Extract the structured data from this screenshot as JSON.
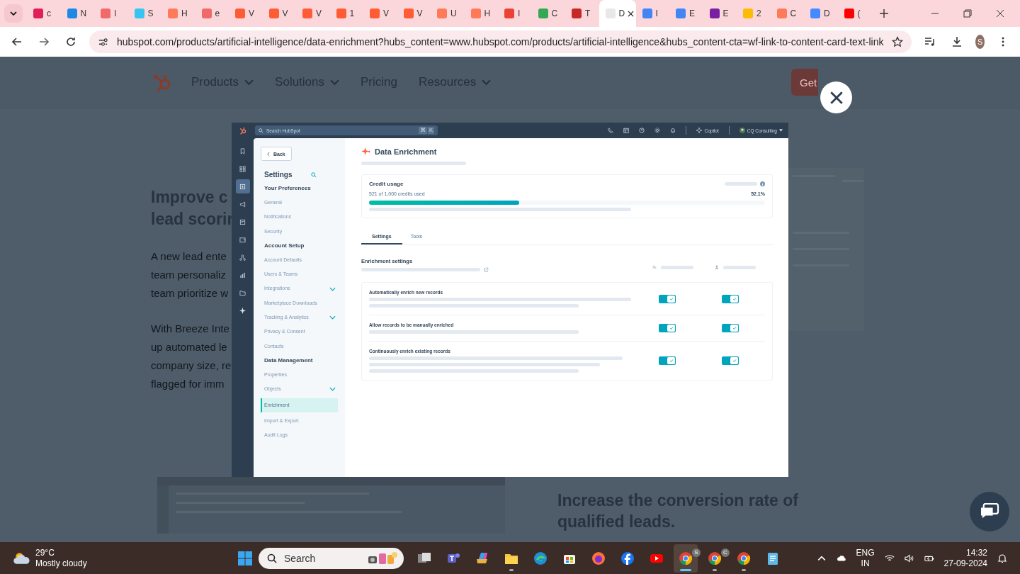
{
  "browser": {
    "tabs": [
      {
        "title": "c",
        "color": "#e01e5a",
        "selected": false
      },
      {
        "title": "N",
        "color": "#1e88e5",
        "selected": false
      },
      {
        "title": "I",
        "color": "#f06a6a",
        "selected": false
      },
      {
        "title": "S",
        "color": "#36c5f0",
        "selected": false
      },
      {
        "title": "H",
        "color": "#ff7a59",
        "selected": false
      },
      {
        "title": "e",
        "color": "#f06a6a",
        "selected": false
      },
      {
        "title": "V",
        "color": "#ff5c35",
        "selected": false
      },
      {
        "title": "V",
        "color": "#ff5c35",
        "selected": false
      },
      {
        "title": "V",
        "color": "#ff5c35",
        "selected": false
      },
      {
        "title": "1",
        "color": "#ff5c35",
        "selected": false
      },
      {
        "title": "V",
        "color": "#ff5c35",
        "selected": false
      },
      {
        "title": "V",
        "color": "#ff5c35",
        "selected": false
      },
      {
        "title": "U",
        "color": "#ff7a59",
        "selected": false
      },
      {
        "title": "H",
        "color": "#ff7a59",
        "selected": false
      },
      {
        "title": "I",
        "color": "#ea4335",
        "selected": false
      },
      {
        "title": "C",
        "color": "#34a853",
        "selected": false
      },
      {
        "title": "T",
        "color": "#c62828",
        "selected": false
      },
      {
        "title": "D",
        "color": "#e8e8e8",
        "selected": true
      },
      {
        "title": "I",
        "color": "#4285f4",
        "selected": false
      },
      {
        "title": "E",
        "color": "#4285f4",
        "selected": false
      },
      {
        "title": "E",
        "color": "#7b1fa2",
        "selected": false
      },
      {
        "title": "2",
        "color": "#fbbc05",
        "selected": false
      },
      {
        "title": "C",
        "color": "#ff7a59",
        "selected": false
      },
      {
        "title": "D",
        "color": "#448aff",
        "selected": false
      },
      {
        "title": "(",
        "color": "#ff0000",
        "selected": false
      }
    ],
    "url": "hubspot.com/products/artificial-intelligence/data-enrichment?hubs_content=www.hubspot.com/products/artificial-intelligence&hubs_content-cta=wf-link-to-content-card-text-link",
    "profile_initial": "S"
  },
  "page": {
    "nav": [
      {
        "label": "Products",
        "has_menu": true
      },
      {
        "label": "Solutions",
        "has_menu": true
      },
      {
        "label": "Pricing",
        "has_menu": false
      },
      {
        "label": "Resources",
        "has_menu": true
      }
    ],
    "demo_button": "Get",
    "headline_lines": [
      "Improve c",
      "lead scorir"
    ],
    "paragraph_1": [
      "A new lead ente",
      "team personaliz",
      "team prioritize w"
    ],
    "paragraph_2": [
      "With Breeze Inte",
      "up automated le",
      "company size, re",
      "flagged for imm"
    ],
    "section_heading_lines": [
      "Increase the conversion rate of",
      "qualified leads."
    ]
  },
  "modal": {
    "search_placeholder": "Search HubSpot",
    "shortcut_keys": [
      "⌘",
      "K"
    ],
    "copilot": "Copilot",
    "account": "CQ Consulting",
    "rail": [
      {
        "kind": "bookmark",
        "selected": false
      },
      {
        "kind": "grid",
        "selected": false
      },
      {
        "kind": "inbox",
        "selected": true
      },
      {
        "kind": "megaphone",
        "selected": false
      },
      {
        "kind": "document",
        "selected": false
      },
      {
        "kind": "wallet",
        "selected": false
      },
      {
        "kind": "network",
        "selected": false
      },
      {
        "kind": "chart",
        "selected": false
      },
      {
        "kind": "folder",
        "selected": false
      },
      {
        "kind": "sparkle",
        "selected": false
      }
    ],
    "back": "Back",
    "settings_title": "Settings",
    "nav_groups": [
      {
        "heading": "Your Preferences",
        "items": [
          {
            "label": "General",
            "expandable": false,
            "selected": false
          },
          {
            "label": "Notifications",
            "expandable": false,
            "selected": false
          },
          {
            "label": "Security",
            "expandable": false,
            "selected": false
          }
        ]
      },
      {
        "heading": "Account Setup",
        "items": [
          {
            "label": "Account Defaults",
            "expandable": false,
            "selected": false
          },
          {
            "label": "Users & Teams",
            "expandable": false,
            "selected": false
          },
          {
            "label": "Integrations",
            "expandable": true,
            "selected": false
          },
          {
            "label": "Marketplace Downloads",
            "expandable": false,
            "selected": false
          },
          {
            "label": "Tracking & Analytics",
            "expandable": true,
            "selected": false
          },
          {
            "label": "Privacy & Consent",
            "expandable": false,
            "selected": false
          },
          {
            "label": "Contacts",
            "expandable": false,
            "selected": false
          }
        ]
      },
      {
        "heading": "Data Management",
        "items": [
          {
            "label": "Properties",
            "expandable": false,
            "selected": false
          },
          {
            "label": "Objects",
            "expandable": true,
            "selected": false
          },
          {
            "label": "Enrichment",
            "expandable": false,
            "selected": true
          },
          {
            "label": "Import & Export",
            "expandable": false,
            "selected": false
          },
          {
            "label": "Audit Logs",
            "expandable": false,
            "selected": false
          }
        ]
      }
    ],
    "title": "Data Enrichment",
    "credit": {
      "title": "Credit usage",
      "used": "521 of 1,000 credits used",
      "percent": "52.1%",
      "level": 0.38
    },
    "tabs": [
      {
        "label": "Settings",
        "selected": true
      },
      {
        "label": "Tools",
        "selected": false
      }
    ],
    "section_title": "Enrichment settings",
    "settings": [
      {
        "label": "Automatically enrich new records",
        "toggles": [
          {
            "on": true
          },
          {
            "on": true
          }
        ]
      },
      {
        "label": "Allow records to be manually enriched",
        "toggles": [
          {
            "on": true
          },
          {
            "on": true
          }
        ]
      },
      {
        "label": "Continuously enrich existing records",
        "toggles": [
          {
            "on": true
          },
          {
            "on": true
          }
        ]
      }
    ]
  },
  "taskbar": {
    "temperature": "29°C",
    "weather": "Mostly cloudy",
    "search": "Search",
    "apps": [
      {
        "kind": "task-view",
        "running": false,
        "active": false
      },
      {
        "kind": "teams",
        "running": false,
        "active": false
      },
      {
        "kind": "copilot",
        "running": false,
        "active": false
      },
      {
        "kind": "files",
        "running": true,
        "active": false
      },
      {
        "kind": "edge",
        "running": false,
        "active": false
      },
      {
        "kind": "store",
        "running": false,
        "active": false
      },
      {
        "kind": "firefox",
        "running": false,
        "active": false
      },
      {
        "kind": "facebook",
        "running": false,
        "active": false
      },
      {
        "kind": "youtube",
        "running": false,
        "active": false
      },
      {
        "kind": "chrome",
        "running": true,
        "active": true,
        "badge": "S"
      },
      {
        "kind": "chrome",
        "running": true,
        "active": false,
        "badge": "C"
      },
      {
        "kind": "chrome",
        "running": true,
        "active": false
      },
      {
        "kind": "notepad",
        "running": false,
        "active": false
      }
    ],
    "language": "ENG",
    "region": "IN",
    "time": "14:32",
    "date": "27-09-2024"
  }
}
